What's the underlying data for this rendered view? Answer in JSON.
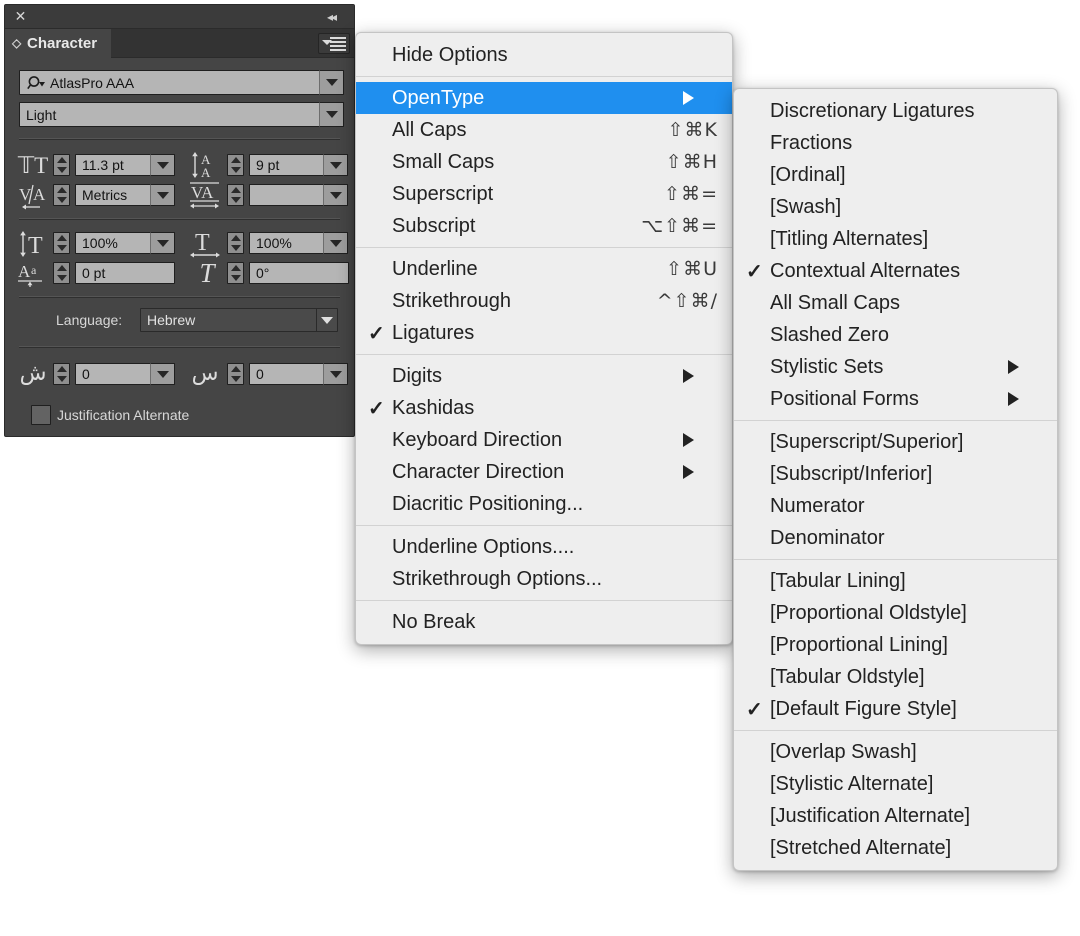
{
  "panel": {
    "title": "Character",
    "close_icon": "close-icon",
    "collapse_icon": "collapse-panel-icon",
    "menu_icon": "panel-menu-icon",
    "font_family": "AtlasPro AAA",
    "font_style": "Light",
    "font_size": "11.3 pt",
    "leading": "9 pt",
    "kerning": "Metrics",
    "tracking": "",
    "vertical_scale": "100%",
    "horizontal_scale": "100%",
    "baseline_shift": "0 pt",
    "rotation": "0°",
    "language_label": "Language:",
    "language_value": "Hebrew",
    "kashida_left": "0",
    "kashida_right": "0",
    "justification_alternate_label": "Justification Alternate"
  },
  "menu": {
    "groups": [
      {
        "items": [
          {
            "label": "Hide Options",
            "shortcut": "",
            "checked": false,
            "submenu": false,
            "selected": false
          }
        ]
      },
      {
        "items": [
          {
            "label": "OpenType",
            "shortcut": "",
            "checked": false,
            "submenu": true,
            "selected": true
          },
          {
            "label": "All Caps",
            "shortcut": "⇧⌘K",
            "checked": false,
            "submenu": false,
            "selected": false
          },
          {
            "label": "Small Caps",
            "shortcut": "⇧⌘H",
            "checked": false,
            "submenu": false,
            "selected": false
          },
          {
            "label": "Superscript",
            "shortcut": "⇧⌘=",
            "checked": false,
            "submenu": false,
            "selected": false
          },
          {
            "label": "Subscript",
            "shortcut": "⌥⇧⌘=",
            "checked": false,
            "submenu": false,
            "selected": false
          }
        ]
      },
      {
        "items": [
          {
            "label": "Underline",
            "shortcut": "⇧⌘U",
            "checked": false,
            "submenu": false,
            "selected": false
          },
          {
            "label": "Strikethrough",
            "shortcut": "^⇧⌘/",
            "checked": false,
            "submenu": false,
            "selected": false
          },
          {
            "label": "Ligatures",
            "shortcut": "",
            "checked": true,
            "submenu": false,
            "selected": false
          }
        ]
      },
      {
        "items": [
          {
            "label": "Digits",
            "shortcut": "",
            "checked": false,
            "submenu": true,
            "selected": false
          },
          {
            "label": "Kashidas",
            "shortcut": "",
            "checked": true,
            "submenu": false,
            "selected": false
          },
          {
            "label": "Keyboard Direction",
            "shortcut": "",
            "checked": false,
            "submenu": true,
            "selected": false
          },
          {
            "label": "Character Direction",
            "shortcut": "",
            "checked": false,
            "submenu": true,
            "selected": false
          },
          {
            "label": "Diacritic Positioning...",
            "shortcut": "",
            "checked": false,
            "submenu": false,
            "selected": false
          }
        ]
      },
      {
        "items": [
          {
            "label": "Underline Options....",
            "shortcut": "",
            "checked": false,
            "submenu": false,
            "selected": false
          },
          {
            "label": "Strikethrough Options...",
            "shortcut": "",
            "checked": false,
            "submenu": false,
            "selected": false
          }
        ]
      },
      {
        "items": [
          {
            "label": "No Break",
            "shortcut": "",
            "checked": false,
            "submenu": false,
            "selected": false
          }
        ]
      }
    ]
  },
  "submenu": {
    "groups": [
      {
        "items": [
          {
            "label": "Discretionary Ligatures",
            "checked": false,
            "submenu": false
          },
          {
            "label": "Fractions",
            "checked": false,
            "submenu": false
          },
          {
            "label": "[Ordinal]",
            "checked": false,
            "submenu": false
          },
          {
            "label": "[Swash]",
            "checked": false,
            "submenu": false
          },
          {
            "label": "[Titling Alternates]",
            "checked": false,
            "submenu": false
          },
          {
            "label": "Contextual Alternates",
            "checked": true,
            "submenu": false
          },
          {
            "label": "All Small Caps",
            "checked": false,
            "submenu": false
          },
          {
            "label": "Slashed Zero",
            "checked": false,
            "submenu": false
          },
          {
            "label": "Stylistic Sets",
            "checked": false,
            "submenu": true
          },
          {
            "label": "Positional Forms",
            "checked": false,
            "submenu": true
          }
        ]
      },
      {
        "items": [
          {
            "label": "[Superscript/Superior]",
            "checked": false,
            "submenu": false
          },
          {
            "label": "[Subscript/Inferior]",
            "checked": false,
            "submenu": false
          },
          {
            "label": "Numerator",
            "checked": false,
            "submenu": false
          },
          {
            "label": "Denominator",
            "checked": false,
            "submenu": false
          }
        ]
      },
      {
        "items": [
          {
            "label": "[Tabular Lining]",
            "checked": false,
            "submenu": false
          },
          {
            "label": "[Proportional Oldstyle]",
            "checked": false,
            "submenu": false
          },
          {
            "label": "[Proportional Lining]",
            "checked": false,
            "submenu": false
          },
          {
            "label": "[Tabular Oldstyle]",
            "checked": false,
            "submenu": false
          },
          {
            "label": "[Default Figure Style]",
            "checked": true,
            "submenu": false
          }
        ]
      },
      {
        "items": [
          {
            "label": "[Overlap Swash]",
            "checked": false,
            "submenu": false
          },
          {
            "label": "[Stylistic Alternate]",
            "checked": false,
            "submenu": false
          },
          {
            "label": "[Justification Alternate]",
            "checked": false,
            "submenu": false
          },
          {
            "label": "[Stretched Alternate]",
            "checked": false,
            "submenu": false
          }
        ]
      }
    ]
  },
  "colors": {
    "menu_highlight": "#1f8fef",
    "menu_background": "#eeeeee",
    "panel_background": "#454545",
    "field_background": "#b5b5b5"
  }
}
